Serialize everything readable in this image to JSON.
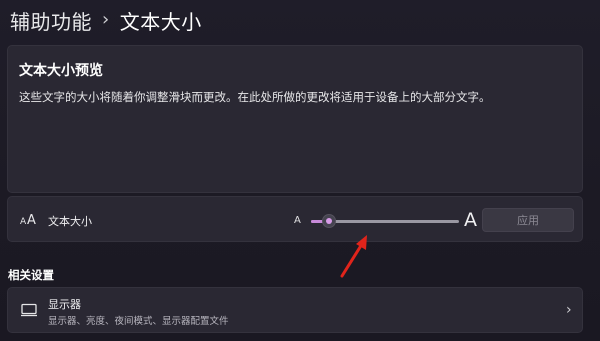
{
  "breadcrumb": {
    "parent": "辅助功能",
    "separator": "›",
    "current": "文本大小"
  },
  "preview": {
    "title": "文本大小预览",
    "text": "这些文字的大小将随着你调整滑块而更改。在此处所做的更改将适用于设备上的大部分文字。"
  },
  "text_size": {
    "icon": "text-size-icon",
    "label": "文本大小",
    "small_marker": "A",
    "large_marker": "A",
    "slider_value_fraction": 0.12,
    "apply_label": "应用"
  },
  "related": {
    "section_title": "相关设置",
    "display": {
      "icon": "monitor-icon",
      "title": "显示器",
      "subtitle": "显示器、亮度、夜间模式、显示器配置文件",
      "chevron": "›"
    }
  },
  "colors": {
    "accent": "#c78ad9",
    "annotation_arrow": "#e0241b",
    "background": "#1e1c26",
    "card": "#2a2833"
  }
}
